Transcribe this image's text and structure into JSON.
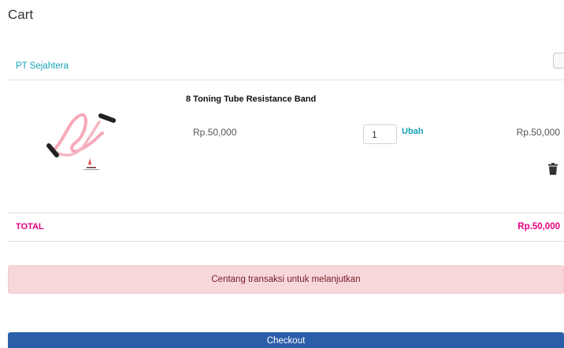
{
  "page": {
    "title": "Cart"
  },
  "store": {
    "name": "PT Sejahtera"
  },
  "item": {
    "name": "8 Toning Tube Resistance Band",
    "unit_price": "Rp.50,000",
    "quantity": "1",
    "update_label": "Ubah",
    "line_total": "Rp.50,000",
    "image_icon": "resistance-band-image",
    "delete_icon": "trash-icon"
  },
  "total": {
    "label": "TOTAL",
    "value": "Rp.50,000"
  },
  "alert": {
    "message": "Centang transaksi untuk melanjutkan"
  },
  "checkout": {
    "label": "Checkout"
  },
  "colors": {
    "accent_teal": "#17a2b8",
    "total_pink": "#e6007e",
    "alert_bg": "#f8d7da",
    "alert_text": "#721c24",
    "checkout_blue": "#2a5ea8"
  }
}
